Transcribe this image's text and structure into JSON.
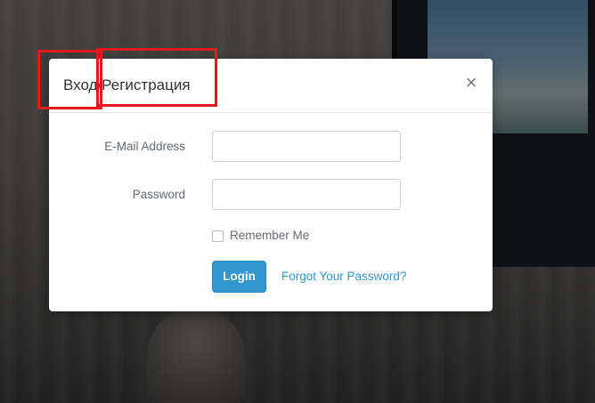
{
  "modal": {
    "title": "Вход/Регистрация",
    "close_label": "×"
  },
  "form": {
    "email_label": "E-Mail Address",
    "email_value": "",
    "password_label": "Password",
    "password_value": "",
    "remember_label": "Remember Me",
    "remember_checked": false,
    "login_label": "Login",
    "forgot_label": "Forgot Your Password?"
  },
  "colors": {
    "primary": "#3097d1",
    "annotation": "#e11919"
  },
  "icons": {
    "close": "close-icon"
  }
}
